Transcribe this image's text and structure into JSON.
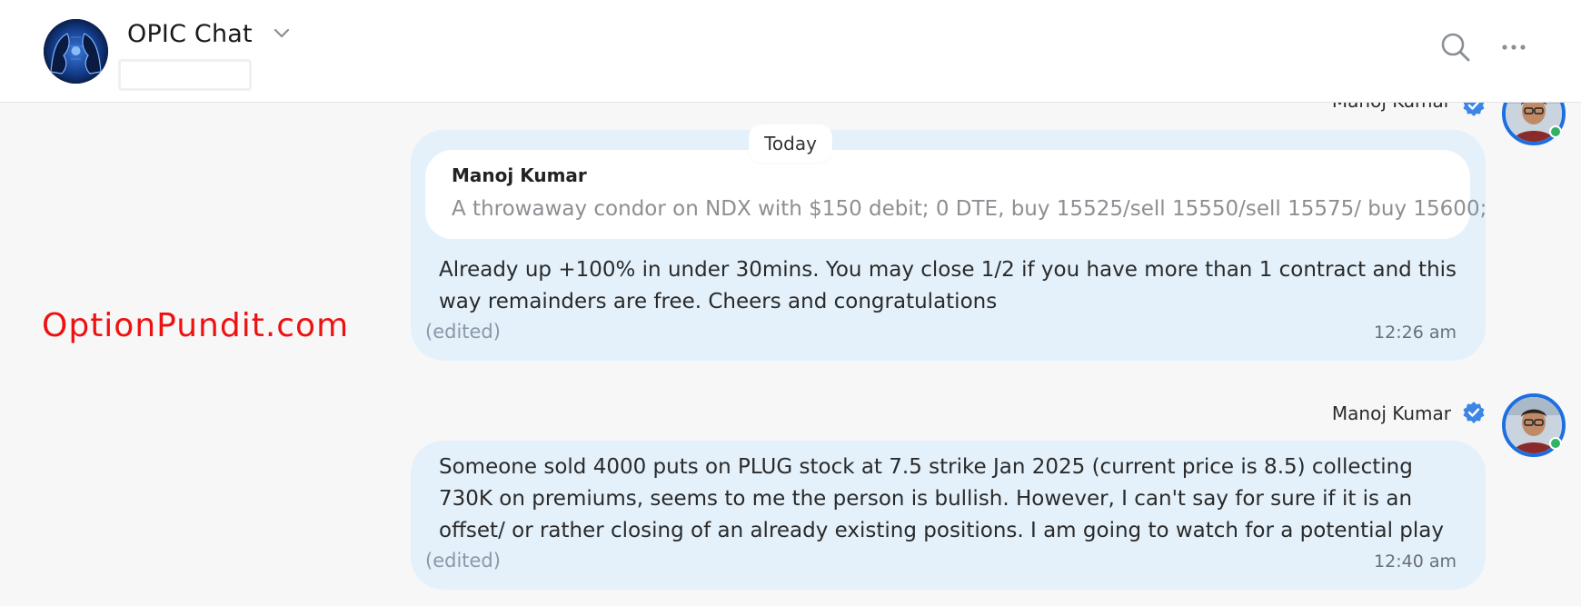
{
  "header": {
    "title": "OPIC Chat",
    "subtitle": "",
    "group_avatar_icon": "group-avatar-icon",
    "search_icon": "search-icon",
    "more_icon": "more-options-icon"
  },
  "watermark": "OptionPundit.com",
  "date_separator": "Today",
  "messages": [
    {
      "sender": "Manoj Kumar",
      "quoted": {
        "author": "Manoj Kumar",
        "text": "A throwaway condor on NDX with $150 debit; 0 DTE, buy 15525/sell 15550/sell 15575/ buy 15600;"
      },
      "text": "Already up +100% in under 30mins. You may close 1/2 if you have more than 1 contract and this way remainders are free. Cheers and congratulations",
      "edited": "(edited)",
      "time": "12:26 am"
    },
    {
      "sender": "Manoj Kumar",
      "text": "Someone sold 4000 puts on PLUG stock at 7.5 strike Jan 2025 (current price is 8.5) collecting 730K on premiums, seems to me the person is bullish. However, I can't say for sure if it is an offset/ or rather closing of an already existing positions. I am going to watch for a potential play",
      "edited": "(edited)",
      "time": "12:40 am"
    }
  ],
  "colors": {
    "bubble": "#e4f1fb",
    "accent": "#1d6fe0",
    "watermark": "#ee1111",
    "online": "#2fb364"
  }
}
